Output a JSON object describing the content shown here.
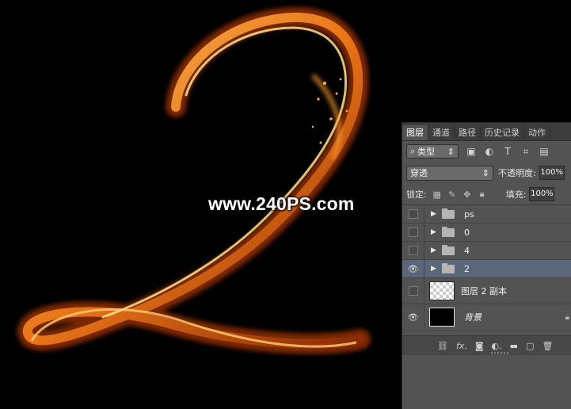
{
  "watermark": "www.240PS.com",
  "panel": {
    "tabs": [
      "图层",
      "通道",
      "路径",
      "历史记录",
      "动作"
    ],
    "filter": {
      "kind_label": "类型",
      "search_glyph": "⌕"
    },
    "blend_mode": "穿透",
    "opacity_label": "不透明度:",
    "opacity_value": "100%",
    "lock_label": "锁定:",
    "fill_label": "填充:",
    "fill_value": "100%",
    "layers": [
      {
        "name": "ps",
        "type": "group",
        "visible": false,
        "selected": false
      },
      {
        "name": "0",
        "type": "group",
        "visible": false,
        "selected": false
      },
      {
        "name": "4",
        "type": "group",
        "visible": false,
        "selected": false
      },
      {
        "name": "2",
        "type": "group",
        "visible": true,
        "selected": true
      },
      {
        "name": "图层 2 副本",
        "type": "layer",
        "visible": false,
        "selected": false
      },
      {
        "name": "背景",
        "type": "background",
        "visible": true,
        "selected": false
      }
    ],
    "bottom_icons": [
      "link-icon",
      "fx-icon",
      "mask-icon",
      "adjustment-icon",
      "folder-icon",
      "new-layer-icon",
      "trash-icon"
    ],
    "colors": {
      "panel_bg": "#535353",
      "selected_row": "#5b6679",
      "flame_core": "#ffb040",
      "flame_edge": "#b83a08"
    }
  }
}
